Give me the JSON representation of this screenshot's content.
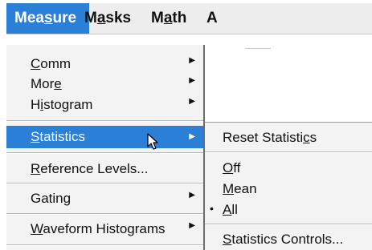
{
  "menubar": {
    "items": [
      {
        "pre": "Mea",
        "mn": "s",
        "post": "ure",
        "active": true
      },
      {
        "pre": "M",
        "mn": "a",
        "post": "sks",
        "active": false
      },
      {
        "pre": "M",
        "mn": "a",
        "post": "th",
        "active": false
      },
      {
        "pre": "",
        "mn": "A",
        "post": "",
        "active": false
      }
    ]
  },
  "measure_menu": {
    "items": [
      {
        "pre": "",
        "mn": "C",
        "post": "omm",
        "submenu": "▶"
      },
      {
        "pre": "Mor",
        "mn": "e",
        "post": "",
        "submenu": "▶"
      },
      {
        "pre": "H",
        "mn": "i",
        "post": "stogram",
        "submenu": "▶"
      },
      {
        "pre": "",
        "mn": "S",
        "post": "tatistics",
        "submenu": "▶"
      },
      {
        "pre": "",
        "mn": "R",
        "post": "eference Levels...",
        "submenu": ""
      },
      {
        "pre": "Gating",
        "mn": "",
        "post": "",
        "submenu": "▶"
      },
      {
        "pre": "",
        "mn": "W",
        "post": "aveform Histograms",
        "submenu": "▶"
      }
    ]
  },
  "statistics_submenu": {
    "items": [
      {
        "pre": "Reset Statisti",
        "mn": "c",
        "post": "s",
        "bullet": ""
      },
      {
        "pre": "",
        "mn": "O",
        "post": "ff",
        "bullet": ""
      },
      {
        "pre": "",
        "mn": "M",
        "post": "ean",
        "bullet": ""
      },
      {
        "pre": "",
        "mn": "A",
        "post": "ll",
        "bullet": "•"
      },
      {
        "pre": "",
        "mn": "S",
        "post": "tatistics Controls...",
        "bullet": ""
      }
    ]
  },
  "colors": {
    "highlight": "#2b7fd6",
    "menu_bg": "#f3f3f3",
    "menubar_bg": "#ededed"
  },
  "icons": {
    "cursor": "mouse-pointer-icon",
    "submenu_arrow": "triangle-right-icon",
    "radio_bullet": "bullet-icon"
  }
}
